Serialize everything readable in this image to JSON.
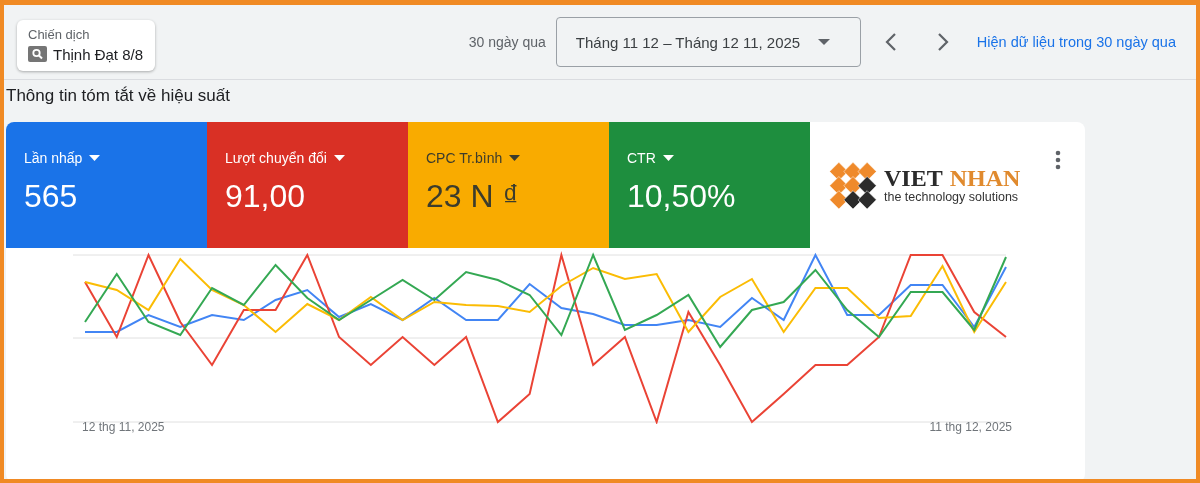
{
  "campaign": {
    "label": "Chiến dịch",
    "name": "Thịnh Đạt 8/8"
  },
  "date_range": {
    "preset": "30 ngày qua",
    "value": "Tháng 11 12 – Tháng 12 11, 2025",
    "link": "Hiện dữ liệu trong 30 ngày qua"
  },
  "section_title": "Thông tin tóm tắt về hiệu suất",
  "metrics": [
    {
      "label": "Lần nhấp",
      "value": "565",
      "color": "#1a73e8",
      "selected": true
    },
    {
      "label": "Lượt chuyển đổi",
      "value": "91,00",
      "color": "#d93025",
      "selected": true
    },
    {
      "label": "CPC Tr.bình",
      "value": "23 N ₫",
      "color": "#f9ab00",
      "selected": true
    },
    {
      "label": "CTR",
      "value": "10,50%",
      "color": "#1e8e3e",
      "selected": true
    }
  ],
  "logo": {
    "name_dark": "VIET",
    "name_accent": "NHAN",
    "tagline": "the technology solutions"
  },
  "chart": {
    "x_start": "12 thg 11, 2025",
    "x_end": "11 thg 12, 2025"
  }
}
